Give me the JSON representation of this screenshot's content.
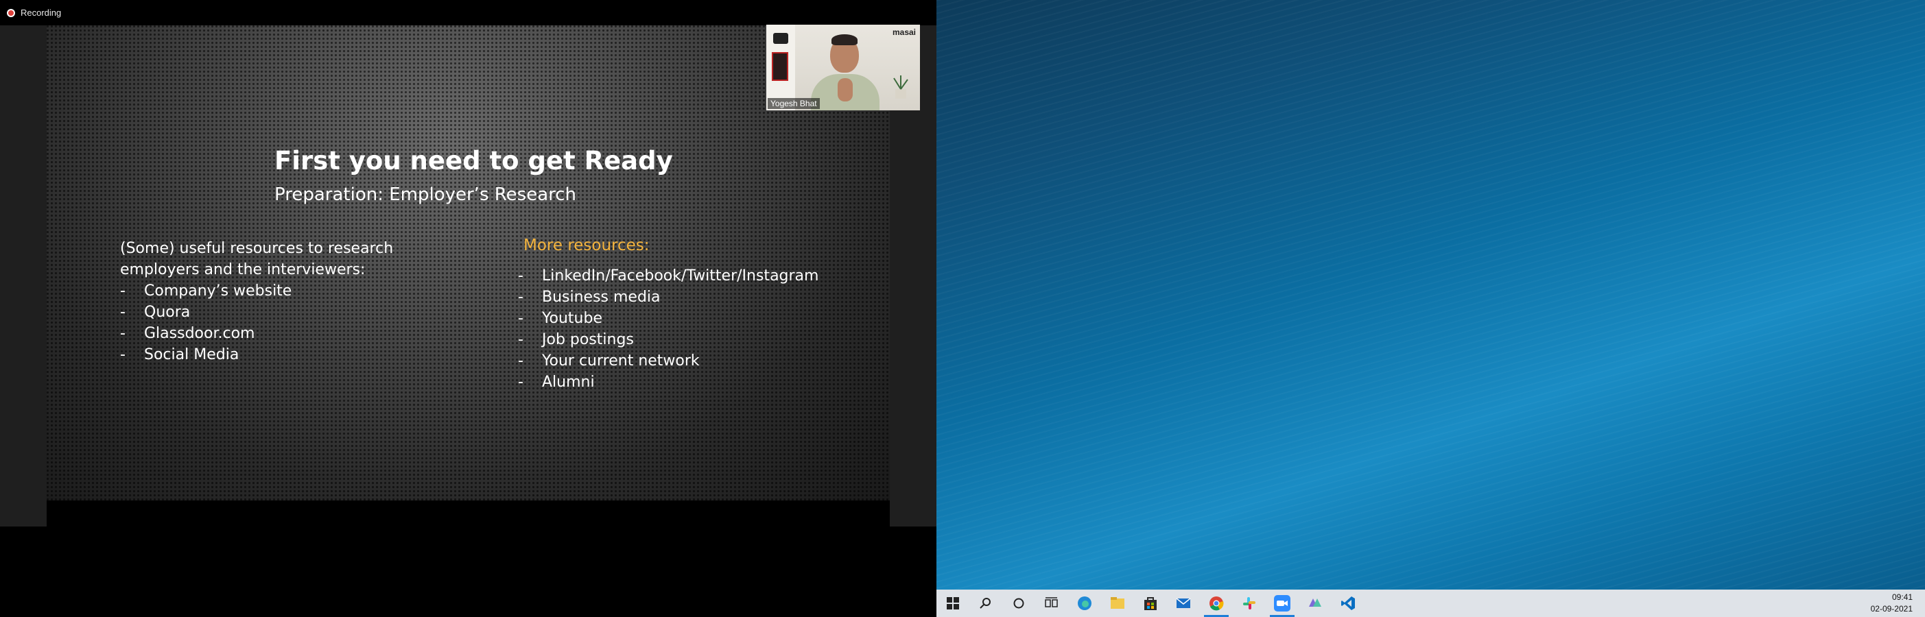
{
  "recording": {
    "label": "Recording"
  },
  "slide": {
    "title": "First you need to get Ready",
    "subtitle": "Preparation: Employer’s Research",
    "left_intro": "(Some) useful resources to research employers and the interviewers:",
    "left_items": [
      "Company’s website",
      "Quora",
      "Glassdoor.com",
      "Social Media"
    ],
    "right_heading": "More resources:",
    "right_items": [
      "LinkedIn/Facebook/Twitter/Instagram",
      "Business media",
      "Youtube",
      "Job postings",
      "Your current network",
      "Alumni"
    ],
    "dash": "-",
    "accent_color": "#f3b33d"
  },
  "webcam": {
    "participant_name": "Yogesh Bhat",
    "logo_text": "masai"
  },
  "taskbar": {
    "icons": [
      "windows-start-icon",
      "search-icon",
      "cortana-icon",
      "task-view-icon",
      "edge-icon",
      "file-explorer-icon",
      "store-icon",
      "mail-icon",
      "chrome-icon",
      "slack-icon",
      "zoom-icon",
      "app-icon",
      "vscode-icon"
    ],
    "time": "09:41",
    "date": "02-09-2021"
  }
}
